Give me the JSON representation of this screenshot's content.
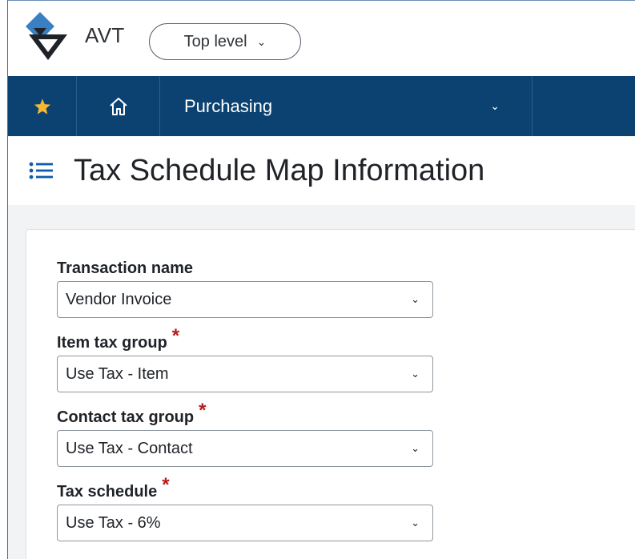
{
  "header": {
    "brand": "AVT",
    "scope_label": "Top level",
    "chevron": "⌄"
  },
  "nav": {
    "module_label": "Purchasing",
    "chevron": "⌄",
    "star_color": "#f5b82e"
  },
  "page": {
    "title": "Tax Schedule Map Information"
  },
  "form": {
    "fields": [
      {
        "label": "Transaction name",
        "value": "Vendor Invoice",
        "required": false
      },
      {
        "label": "Item tax group",
        "value": "Use Tax - Item",
        "required": true
      },
      {
        "label": "Contact tax group",
        "value": "Use Tax - Contact",
        "required": true
      },
      {
        "label": "Tax schedule",
        "value": "Use Tax - 6%",
        "required": true
      }
    ],
    "required_mark": "*"
  },
  "icons": {
    "logo": "company-logo-icon",
    "star": "star-icon",
    "home": "home-icon",
    "menu": "list-menu-icon",
    "chevron": "chevron-down-icon"
  },
  "colors": {
    "nav_bg": "#0b4271",
    "required": "#b71c1c",
    "content_bg": "#f1f3f5"
  }
}
